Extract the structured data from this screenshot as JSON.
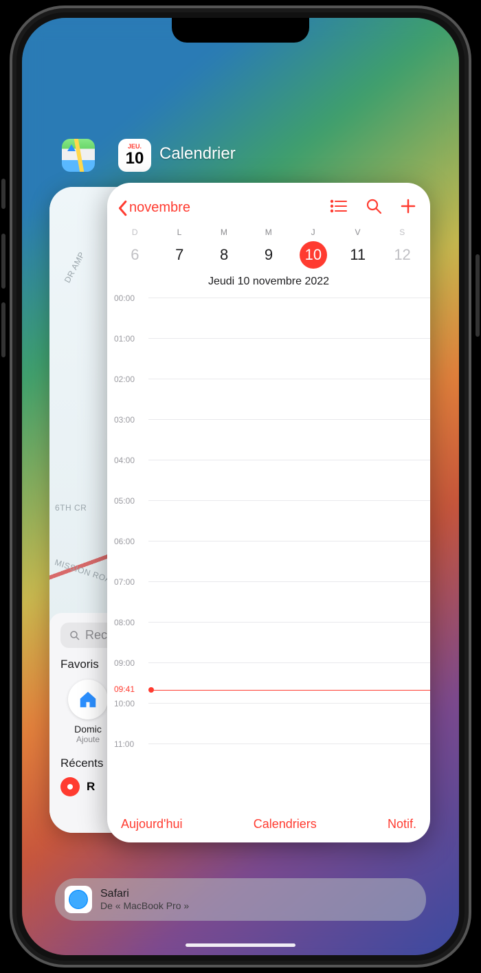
{
  "switcher": {
    "calendar_icon": {
      "dow": "JEU.",
      "day": "10"
    },
    "calendar_label": "Calendrier"
  },
  "maps": {
    "search_placeholder": "Rec",
    "favorites_label": "Favoris",
    "home_label": "Domic",
    "home_sub": "Ajoute",
    "recents_label": "Récents",
    "recent_item": "R",
    "road1": "DR AMP",
    "road2": "6TH CR",
    "road3": "MISSION ROA"
  },
  "calendar": {
    "back_label": "novembre",
    "dows": [
      "D",
      "L",
      "M",
      "M",
      "J",
      "V",
      "S"
    ],
    "dates": [
      "6",
      "7",
      "8",
      "9",
      "10",
      "11",
      "12"
    ],
    "selected_index": 4,
    "full_date": "Jeudi  10 novembre 2022",
    "hours": [
      "00:00",
      "01:00",
      "02:00",
      "03:00",
      "04:00",
      "05:00",
      "06:00",
      "07:00",
      "08:00",
      "09:00",
      "10:00",
      "11:00"
    ],
    "now_label": "09:41",
    "toolbar": {
      "today": "Aujourd'hui",
      "calendars": "Calendriers",
      "inbox": "Notif."
    }
  },
  "handoff": {
    "title": "Safari",
    "subtitle": "De « MacBook Pro »"
  }
}
